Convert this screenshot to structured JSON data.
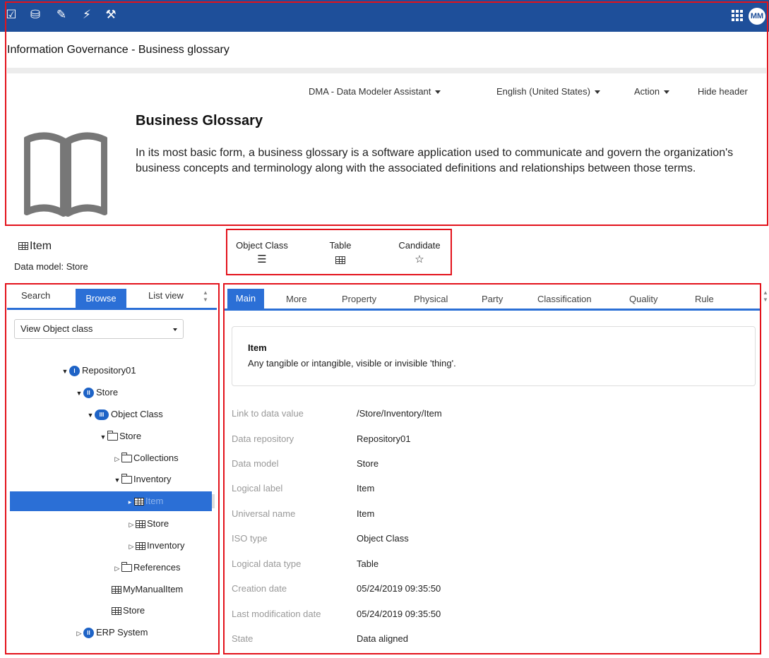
{
  "topbar": {
    "icons": [
      "checkbox-icon",
      "database-icon",
      "edit-check-icon",
      "plug-icon",
      "wrench-icon"
    ],
    "avatar": "MM"
  },
  "app_title": "Information Governance - Business glossary",
  "header": {
    "menus": [
      "DMA - Data Modeler Assistant",
      "English (United States)",
      "Action"
    ],
    "hide_header": "Hide header",
    "title": "Business Glossary",
    "description": "In its most basic form, a business glossary is a software application used to communicate and govern the organization's business concepts and terminology along with the associated definitions and relationships between those terms."
  },
  "item": {
    "title": "Item",
    "data_model": "Data model: Store"
  },
  "object_tabs": [
    {
      "label": "Object Class",
      "icon": "list-icon"
    },
    {
      "label": "Table",
      "icon": "table-icon"
    },
    {
      "label": "Candidate",
      "icon": "star-icon"
    }
  ],
  "left_panel": {
    "tabs": [
      "Search",
      "Browse",
      "List view"
    ],
    "active_tab": "Browse",
    "view_select": "View Object class",
    "tree": [
      {
        "label": "Repository01",
        "badge": "I"
      },
      {
        "label": "Store",
        "badge": "II"
      },
      {
        "label": "Object Class",
        "badge": "III"
      },
      {
        "label": "Store"
      },
      {
        "label": "Collections"
      },
      {
        "label": "Inventory"
      },
      {
        "label": "Item"
      },
      {
        "label": "Store"
      },
      {
        "label": "Inventory"
      },
      {
        "label": "References"
      },
      {
        "label": "MyManualItem"
      },
      {
        "label": "Store"
      },
      {
        "label": "ERP System",
        "badge": "II"
      }
    ]
  },
  "right_panel": {
    "tabs": [
      "Main",
      "More",
      "Property",
      "Physical",
      "Party",
      "Classification",
      "Quality",
      "Rule"
    ],
    "active_tab": "Main",
    "card": {
      "name": "Item",
      "text": "Any tangible or intangible, visible or invisible 'thing'."
    },
    "properties": [
      {
        "label": "Link to data value",
        "value": "/Store/Inventory/Item"
      },
      {
        "label": "Data repository",
        "value": "Repository01"
      },
      {
        "label": "Data model",
        "value": "Store"
      },
      {
        "label": "Logical label",
        "value": "Item"
      },
      {
        "label": "Universal name",
        "value": "Item"
      },
      {
        "label": "ISO type",
        "value": "Object Class"
      },
      {
        "label": "Logical data type",
        "value": "Table"
      },
      {
        "label": "Creation date",
        "value": "05/24/2019 09:35:50"
      },
      {
        "label": "Last modification date",
        "value": "05/24/2019 09:35:50"
      },
      {
        "label": "State",
        "value": "Data aligned"
      }
    ]
  },
  "colors": {
    "topbar": "#1e4f9a",
    "accent": "#2b6fd6",
    "badge": "#1e63c6",
    "highlight_box": "#e3121b"
  }
}
